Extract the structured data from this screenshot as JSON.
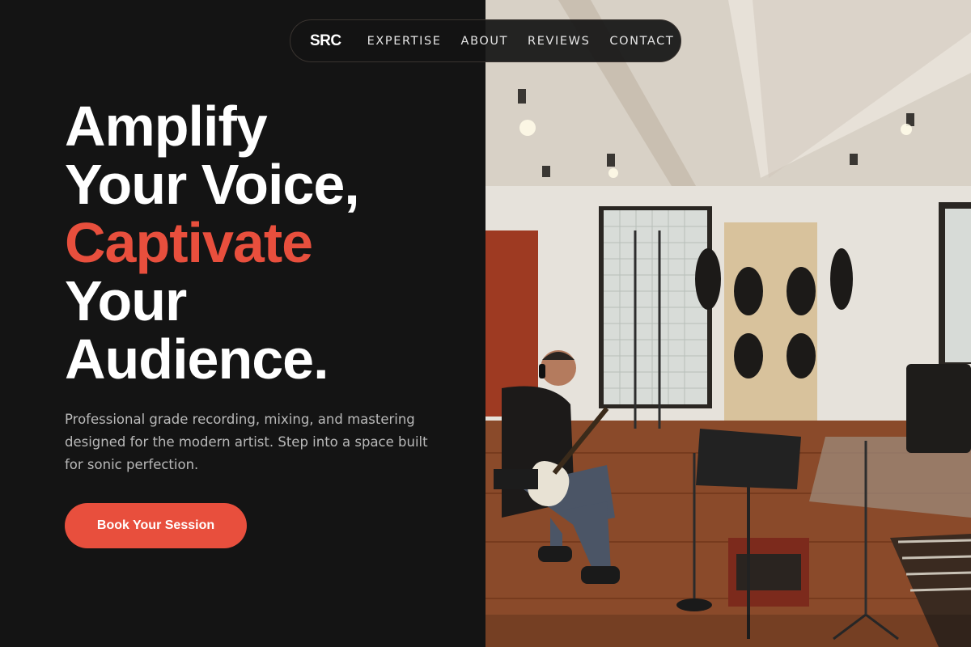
{
  "nav": {
    "logo": "SRC",
    "links": [
      "EXPERTISE",
      "ABOUT",
      "REVIEWS",
      "CONTACT"
    ]
  },
  "hero": {
    "headline_lines": [
      "Amplify",
      "Your Voice,",
      "Captivate",
      "Your",
      "Audience."
    ],
    "accent_line": "Captivate",
    "lead": "Professional grade recording, mixing, and mastering designed for the modern artist. Step into a space built for sonic perfection.",
    "cta_label": "Book Your Session",
    "image_subject": "studio-photo"
  },
  "colors": {
    "background": "#141414",
    "accent": "#e84f3d",
    "text_primary": "#ffffff",
    "text_muted": "#b9b9b9"
  }
}
